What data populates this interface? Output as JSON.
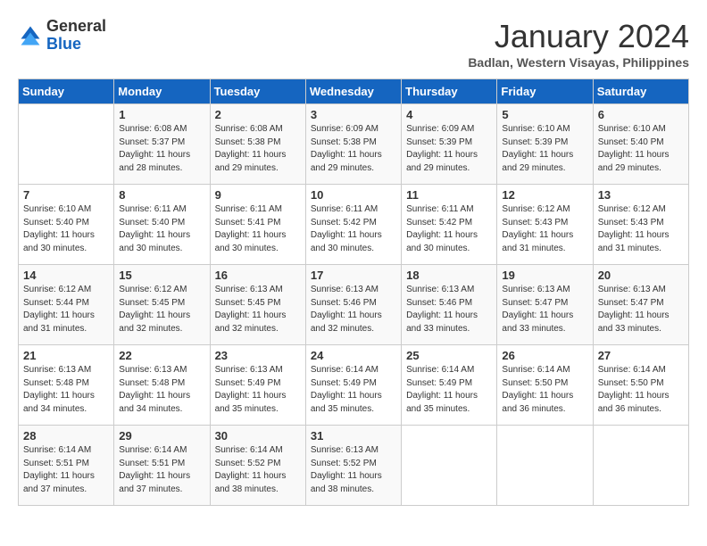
{
  "header": {
    "logo_general": "General",
    "logo_blue": "Blue",
    "month_title": "January 2024",
    "location": "Badlan, Western Visayas, Philippines"
  },
  "days_of_week": [
    "Sunday",
    "Monday",
    "Tuesday",
    "Wednesday",
    "Thursday",
    "Friday",
    "Saturday"
  ],
  "weeks": [
    [
      {
        "day": "",
        "sunrise": "",
        "sunset": "",
        "daylight": ""
      },
      {
        "day": "1",
        "sunrise": "Sunrise: 6:08 AM",
        "sunset": "Sunset: 5:37 PM",
        "daylight": "Daylight: 11 hours and 28 minutes."
      },
      {
        "day": "2",
        "sunrise": "Sunrise: 6:08 AM",
        "sunset": "Sunset: 5:38 PM",
        "daylight": "Daylight: 11 hours and 29 minutes."
      },
      {
        "day": "3",
        "sunrise": "Sunrise: 6:09 AM",
        "sunset": "Sunset: 5:38 PM",
        "daylight": "Daylight: 11 hours and 29 minutes."
      },
      {
        "day": "4",
        "sunrise": "Sunrise: 6:09 AM",
        "sunset": "Sunset: 5:39 PM",
        "daylight": "Daylight: 11 hours and 29 minutes."
      },
      {
        "day": "5",
        "sunrise": "Sunrise: 6:10 AM",
        "sunset": "Sunset: 5:39 PM",
        "daylight": "Daylight: 11 hours and 29 minutes."
      },
      {
        "day": "6",
        "sunrise": "Sunrise: 6:10 AM",
        "sunset": "Sunset: 5:40 PM",
        "daylight": "Daylight: 11 hours and 29 minutes."
      }
    ],
    [
      {
        "day": "7",
        "sunrise": "Sunrise: 6:10 AM",
        "sunset": "Sunset: 5:40 PM",
        "daylight": "Daylight: 11 hours and 30 minutes."
      },
      {
        "day": "8",
        "sunrise": "Sunrise: 6:11 AM",
        "sunset": "Sunset: 5:40 PM",
        "daylight": "Daylight: 11 hours and 30 minutes."
      },
      {
        "day": "9",
        "sunrise": "Sunrise: 6:11 AM",
        "sunset": "Sunset: 5:41 PM",
        "daylight": "Daylight: 11 hours and 30 minutes."
      },
      {
        "day": "10",
        "sunrise": "Sunrise: 6:11 AM",
        "sunset": "Sunset: 5:42 PM",
        "daylight": "Daylight: 11 hours and 30 minutes."
      },
      {
        "day": "11",
        "sunrise": "Sunrise: 6:11 AM",
        "sunset": "Sunset: 5:42 PM",
        "daylight": "Daylight: 11 hours and 30 minutes."
      },
      {
        "day": "12",
        "sunrise": "Sunrise: 6:12 AM",
        "sunset": "Sunset: 5:43 PM",
        "daylight": "Daylight: 11 hours and 31 minutes."
      },
      {
        "day": "13",
        "sunrise": "Sunrise: 6:12 AM",
        "sunset": "Sunset: 5:43 PM",
        "daylight": "Daylight: 11 hours and 31 minutes."
      }
    ],
    [
      {
        "day": "14",
        "sunrise": "Sunrise: 6:12 AM",
        "sunset": "Sunset: 5:44 PM",
        "daylight": "Daylight: 11 hours and 31 minutes."
      },
      {
        "day": "15",
        "sunrise": "Sunrise: 6:12 AM",
        "sunset": "Sunset: 5:45 PM",
        "daylight": "Daylight: 11 hours and 32 minutes."
      },
      {
        "day": "16",
        "sunrise": "Sunrise: 6:13 AM",
        "sunset": "Sunset: 5:45 PM",
        "daylight": "Daylight: 11 hours and 32 minutes."
      },
      {
        "day": "17",
        "sunrise": "Sunrise: 6:13 AM",
        "sunset": "Sunset: 5:46 PM",
        "daylight": "Daylight: 11 hours and 32 minutes."
      },
      {
        "day": "18",
        "sunrise": "Sunrise: 6:13 AM",
        "sunset": "Sunset: 5:46 PM",
        "daylight": "Daylight: 11 hours and 33 minutes."
      },
      {
        "day": "19",
        "sunrise": "Sunrise: 6:13 AM",
        "sunset": "Sunset: 5:47 PM",
        "daylight": "Daylight: 11 hours and 33 minutes."
      },
      {
        "day": "20",
        "sunrise": "Sunrise: 6:13 AM",
        "sunset": "Sunset: 5:47 PM",
        "daylight": "Daylight: 11 hours and 33 minutes."
      }
    ],
    [
      {
        "day": "21",
        "sunrise": "Sunrise: 6:13 AM",
        "sunset": "Sunset: 5:48 PM",
        "daylight": "Daylight: 11 hours and 34 minutes."
      },
      {
        "day": "22",
        "sunrise": "Sunrise: 6:13 AM",
        "sunset": "Sunset: 5:48 PM",
        "daylight": "Daylight: 11 hours and 34 minutes."
      },
      {
        "day": "23",
        "sunrise": "Sunrise: 6:13 AM",
        "sunset": "Sunset: 5:49 PM",
        "daylight": "Daylight: 11 hours and 35 minutes."
      },
      {
        "day": "24",
        "sunrise": "Sunrise: 6:14 AM",
        "sunset": "Sunset: 5:49 PM",
        "daylight": "Daylight: 11 hours and 35 minutes."
      },
      {
        "day": "25",
        "sunrise": "Sunrise: 6:14 AM",
        "sunset": "Sunset: 5:49 PM",
        "daylight": "Daylight: 11 hours and 35 minutes."
      },
      {
        "day": "26",
        "sunrise": "Sunrise: 6:14 AM",
        "sunset": "Sunset: 5:50 PM",
        "daylight": "Daylight: 11 hours and 36 minutes."
      },
      {
        "day": "27",
        "sunrise": "Sunrise: 6:14 AM",
        "sunset": "Sunset: 5:50 PM",
        "daylight": "Daylight: 11 hours and 36 minutes."
      }
    ],
    [
      {
        "day": "28",
        "sunrise": "Sunrise: 6:14 AM",
        "sunset": "Sunset: 5:51 PM",
        "daylight": "Daylight: 11 hours and 37 minutes."
      },
      {
        "day": "29",
        "sunrise": "Sunrise: 6:14 AM",
        "sunset": "Sunset: 5:51 PM",
        "daylight": "Daylight: 11 hours and 37 minutes."
      },
      {
        "day": "30",
        "sunrise": "Sunrise: 6:14 AM",
        "sunset": "Sunset: 5:52 PM",
        "daylight": "Daylight: 11 hours and 38 minutes."
      },
      {
        "day": "31",
        "sunrise": "Sunrise: 6:13 AM",
        "sunset": "Sunset: 5:52 PM",
        "daylight": "Daylight: 11 hours and 38 minutes."
      },
      {
        "day": "",
        "sunrise": "",
        "sunset": "",
        "daylight": ""
      },
      {
        "day": "",
        "sunrise": "",
        "sunset": "",
        "daylight": ""
      },
      {
        "day": "",
        "sunrise": "",
        "sunset": "",
        "daylight": ""
      }
    ]
  ]
}
